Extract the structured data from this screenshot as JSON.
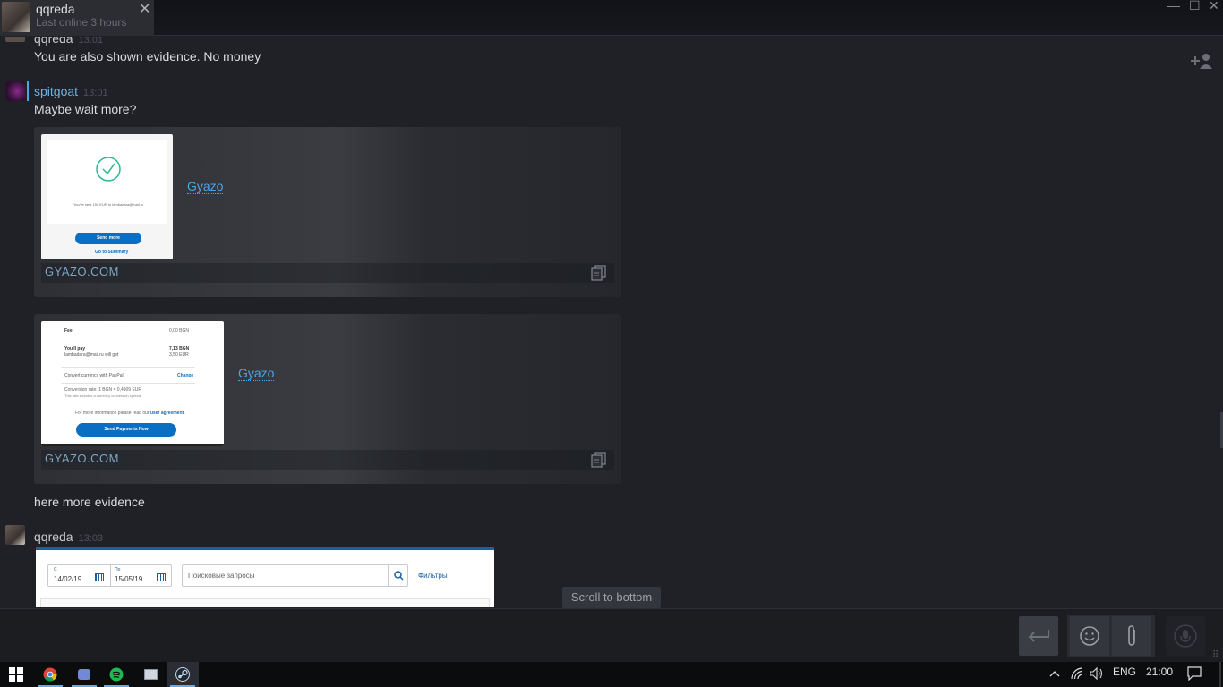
{
  "tab": {
    "name": "qqreda",
    "status": "Last online 3 hours"
  },
  "window_controls": {
    "minimize": "—",
    "maximize": "☐",
    "close": "✕"
  },
  "messages": [
    {
      "sender": "qqreda",
      "time": "13:01",
      "text": "You are also shown evidence. No money"
    },
    {
      "sender": "spitgoat",
      "time": "13:01",
      "text": "Maybe wait more?"
    },
    {
      "sender": "",
      "time": "",
      "text": "here more evidence"
    },
    {
      "sender": "qqreda",
      "time": "13:03",
      "text": ""
    }
  ],
  "embeds": [
    {
      "title": "Gyazo",
      "domain": "GYAZO.COM",
      "thumb": {
        "text": "You've sent 150 EUR to lambadara@mail.ru",
        "button": "Send more",
        "link": "Go to Summary"
      }
    },
    {
      "title": "Gyazo",
      "domain": "GYAZO.COM",
      "thumb": {
        "fee_label": "Fee",
        "fee_value": "0,00 BGN",
        "pay_label": "You'll pay",
        "pay_value": "7,13 BGN",
        "get_label": "lambadara@mail.ru will get",
        "get_value": "3,50 EUR",
        "convert": "Convert currency with PayPal",
        "change": "Change",
        "rate": "Conversion rate: 1 BGN = 0,4909 EUR",
        "rate_note": "This rate includes a currency conversion spread.",
        "info": "For more information please read our",
        "agreement": "user agreement.",
        "button": "Send Payments Now"
      }
    }
  ],
  "screenshot_preview": {
    "from_label": "С",
    "from_value": "14/02/19",
    "to_label": "По",
    "to_value": "15/05/19",
    "search_placeholder": "Поисковые запросы",
    "filters": "Фильтры"
  },
  "scroll_to_bottom": "Scroll to bottom",
  "tray": {
    "language": "ENG",
    "time": "21:00"
  },
  "colors": {
    "accent": "#4ca5e3",
    "sender_friend": "#c7c9cc",
    "sender_spitgoat": "#6fb3e3",
    "background": "#1f2126"
  }
}
